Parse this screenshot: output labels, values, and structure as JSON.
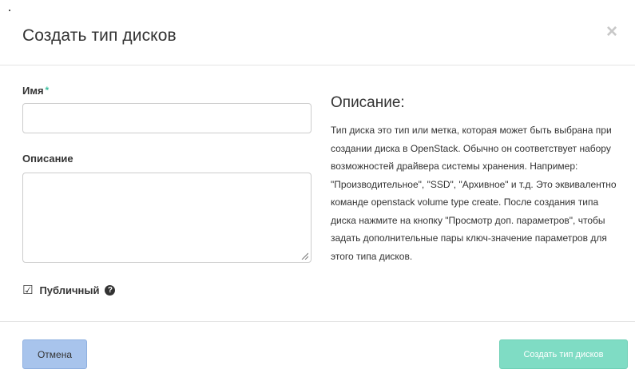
{
  "dialog": {
    "title": "Создать тип дисков",
    "close_icon": "close-icon",
    "close_symbol": "×"
  },
  "form": {
    "name_label": "Имя",
    "name_required_mark": "*",
    "name_value": "",
    "description_label": "Описание",
    "description_value": "",
    "public_label": "Публичный",
    "public_checked": true,
    "public_checkbox_symbol": "☑",
    "help_icon": "question-circle-icon",
    "help_symbol": "?"
  },
  "info": {
    "heading": "Описание:",
    "text": "Тип диска это тип или метка, которая может быть выбрана при создании диска в OpenStack. Обычно он соответствует набору возможностей драйвера системы хранения. Например: \"Производительное\", \"SSD\", \"Архивное\" и т.д. Это эквивалентно команде openstack volume type create. После создания типа диска нажмите на кнопку \"Просмотр доп. параметров\", чтобы задать дополнительные пары ключ-значение параметров для этого типа дисков."
  },
  "footer": {
    "cancel_label": "Отмена",
    "submit_label": "Создать тип дисков"
  },
  "colors": {
    "accent": "#3fbf9f",
    "cancel_bg": "#a8c4ec",
    "submit_bg": "#7fdcc4"
  }
}
